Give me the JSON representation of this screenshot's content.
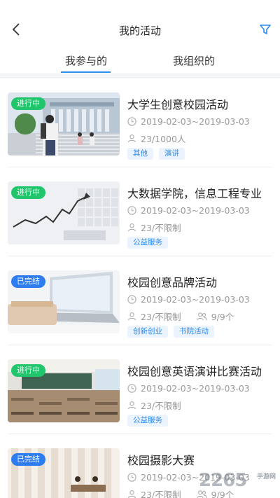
{
  "header": {
    "title": "我的活动",
    "back_icon": "chevron-left-icon",
    "filter_icon": "filter-icon"
  },
  "tabs": [
    {
      "label": "我参与的",
      "active": true
    },
    {
      "label": "我组织的",
      "active": false
    }
  ],
  "activities": [
    {
      "status": "进行中",
      "status_type": "ongoing",
      "name": "大学生创意校园活动",
      "date": "2019-02-03~2019-03-03",
      "people": "23/1000人",
      "groups": "",
      "tags": [
        "其他",
        "演讲"
      ]
    },
    {
      "status": "进行中",
      "status_type": "ongoing",
      "name": "大数据学院，信息工程专业",
      "date": "2019-02-03~2019-03-03",
      "people": "23/不限制",
      "groups": "",
      "tags": [
        "公益服务"
      ]
    },
    {
      "status": "已完结",
      "status_type": "done",
      "name": "校园创意品牌活动",
      "date": "2019-02-03~2019-03-03",
      "people": "23/不限制",
      "groups": "9/9个",
      "tags": [
        "创新创业",
        "书院活动"
      ]
    },
    {
      "status": "进行中",
      "status_type": "ongoing",
      "name": "校园创意英语演讲比赛活动",
      "date": "2019-02-03~2019-03-03",
      "people": "23/不限制",
      "groups": "",
      "tags": [
        "公益服务"
      ]
    },
    {
      "status": "已完结",
      "status_type": "done",
      "name": "校园摄影大赛",
      "date": "2019-02-03~2019-03-03",
      "people": "23/不限制",
      "groups": "9/9个",
      "tags": []
    }
  ],
  "watermark": {
    "text": "2265",
    "sub": "手游网"
  },
  "colors": {
    "accent": "#2d8cf0",
    "ongoing": "#21c56b",
    "done": "#2d7cf0",
    "tag_bg": "#eaf3fe"
  }
}
